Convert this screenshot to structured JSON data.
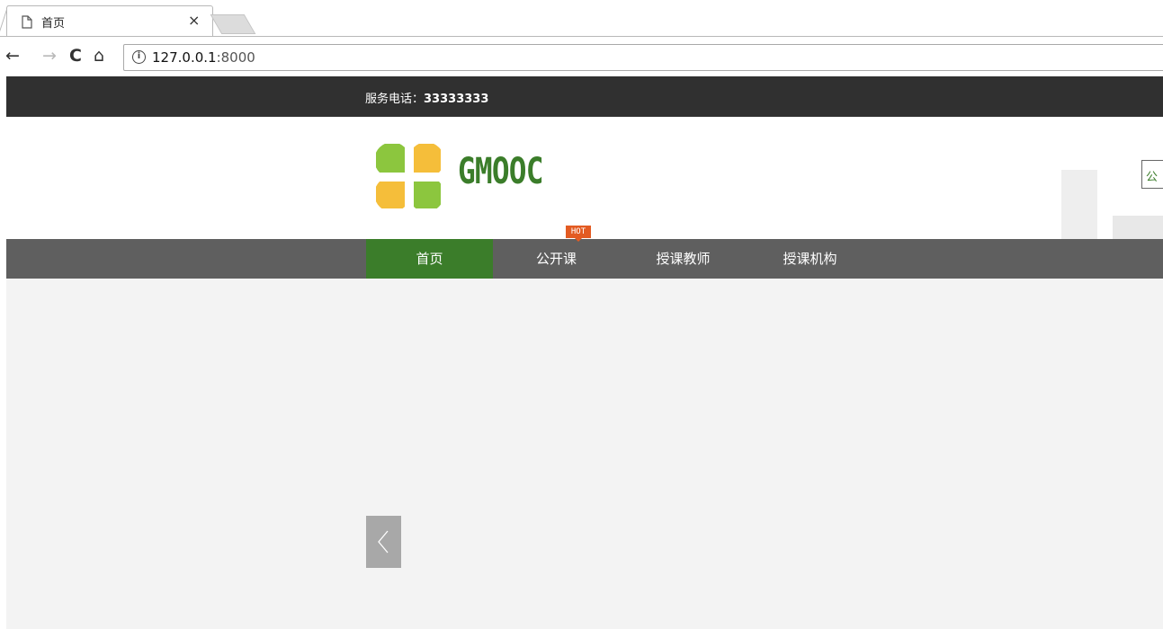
{
  "browser": {
    "tab_title": "首页",
    "tab_close": "×",
    "address_host": "127.0.0.1",
    "address_port": ":8000",
    "back_glyph": "←",
    "forward_glyph": "→",
    "reload_glyph": "C",
    "home_glyph": "⌂",
    "info_glyph": "i"
  },
  "topbar": {
    "service_label": "服务电话：",
    "service_phone": "33333333"
  },
  "header": {
    "brand": "GMOOC",
    "right_button_label": "公",
    "logo_colors": {
      "yellow": "#f5be3a",
      "green": "#8cc63e"
    }
  },
  "nav": {
    "items": [
      {
        "label": "首页"
      },
      {
        "label": "公开课"
      },
      {
        "label": "授课教师"
      },
      {
        "label": "授课机构"
      }
    ],
    "active_index": 0,
    "hot_badge": "HOT"
  },
  "colors": {
    "topbar_bg": "#303030",
    "nav_bg": "#5f5f5f",
    "nav_active_bg": "#3b7d2a",
    "brand": "#3b7d2a",
    "hot_badge": "#e35b22",
    "banner_bg": "#f3f3f3"
  }
}
